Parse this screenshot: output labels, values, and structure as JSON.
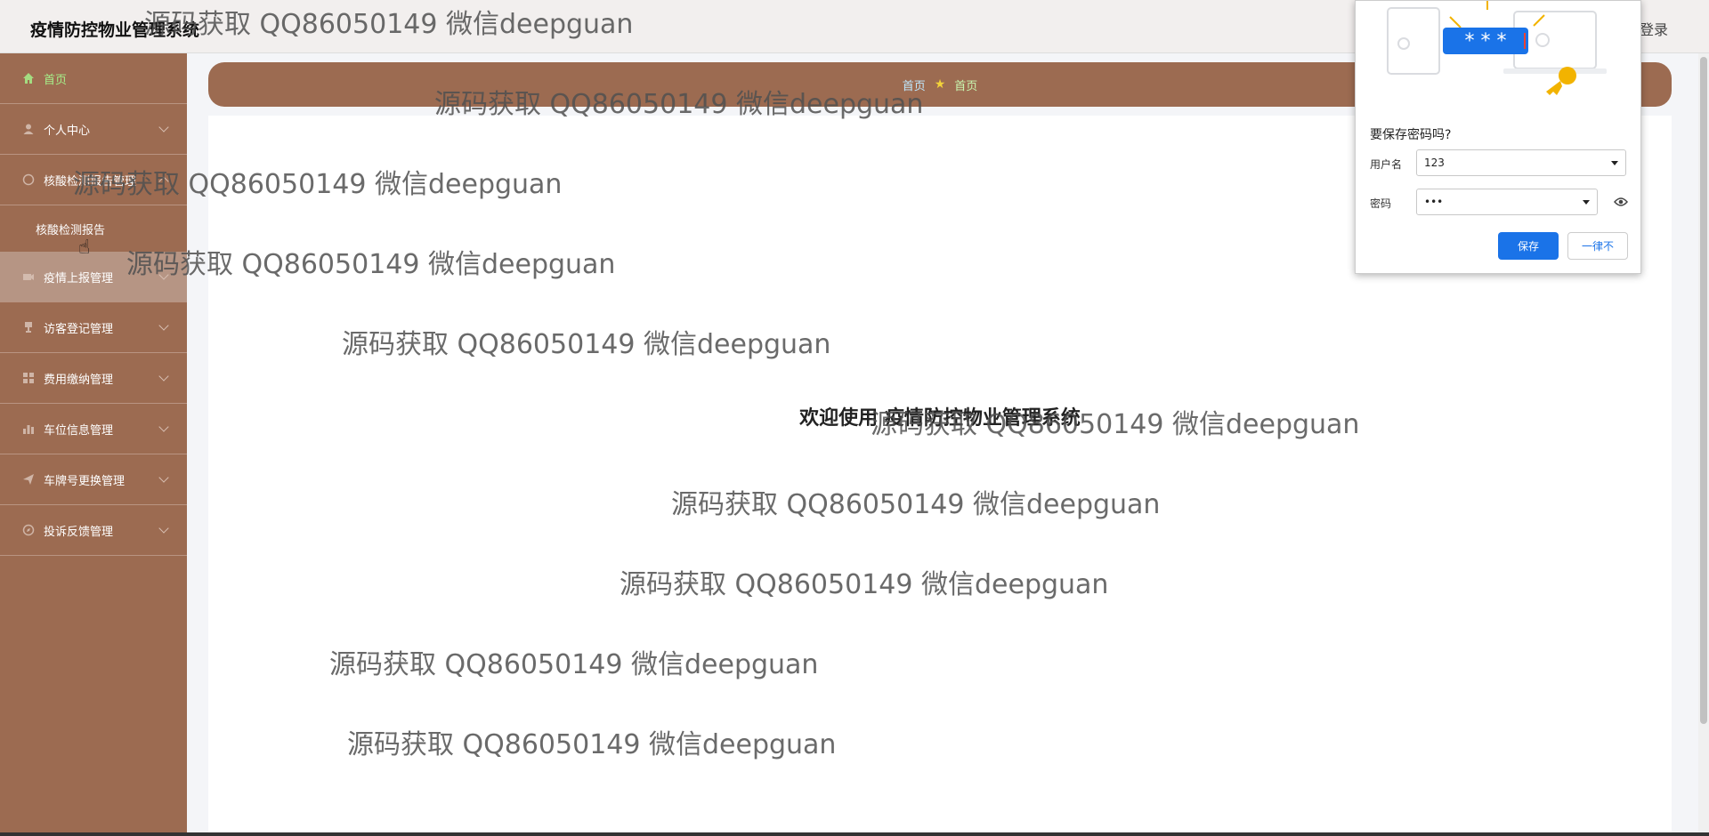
{
  "header": {
    "app_title": "疫情防控物业管理系统",
    "logout_label": "登录"
  },
  "sidebar": {
    "items": [
      {
        "label": "首页",
        "icon": "home-icon"
      },
      {
        "label": "个人中心",
        "icon": "user-icon"
      },
      {
        "label": "核酸检测报告管理",
        "icon": "report-icon"
      },
      {
        "label": "核酸检测报告",
        "icon": ""
      },
      {
        "label": "疫情上报管理",
        "icon": "camera-icon"
      },
      {
        "label": "访客登记管理",
        "icon": "trophy-icon"
      },
      {
        "label": "费用缴纳管理",
        "icon": "grid-icon"
      },
      {
        "label": "车位信息管理",
        "icon": "bar-chart-icon"
      },
      {
        "label": "车牌号更换管理",
        "icon": "send-icon"
      },
      {
        "label": "投诉反馈管理",
        "icon": "compass-icon"
      }
    ]
  },
  "breadcrumb": {
    "first": "首页",
    "second": "首页"
  },
  "main": {
    "welcome": "欢迎使用 疫情防控物业管理系统"
  },
  "watermark_text": "源码获取 QQ86050149 微信deepguan",
  "password_dialog": {
    "question": "要保存密码吗?",
    "username_label": "用户名",
    "username_value": "123",
    "password_label": "密码",
    "password_value": "•••",
    "save_label": "保存",
    "never_label": "一律不",
    "illustration_stars": "* * *"
  },
  "colors": {
    "sidebar_bg": "#9c6b51",
    "active_text": "#a6f08a",
    "accent_blue": "#1a73e8"
  }
}
